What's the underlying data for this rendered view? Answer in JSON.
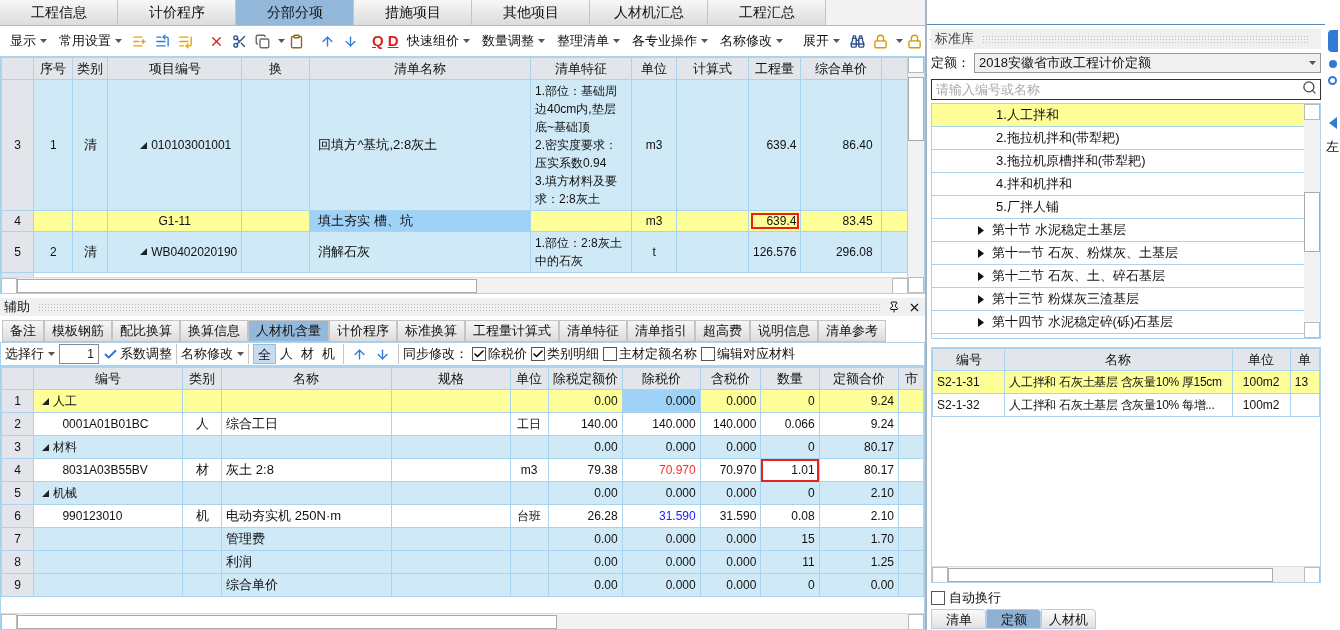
{
  "main_tabs": [
    {
      "label": "工程信息",
      "selected": false
    },
    {
      "label": "计价程序",
      "selected": false
    },
    {
      "label": "分部分项",
      "selected": true
    },
    {
      "label": "措施项目",
      "selected": false
    },
    {
      "label": "其他项目",
      "selected": false
    },
    {
      "label": "人材机汇总",
      "selected": false
    },
    {
      "label": "工程汇总",
      "selected": false
    }
  ],
  "toolbar": {
    "menus_left": [
      "显示",
      "常用设置"
    ],
    "letter_icons": [
      "Q",
      "D"
    ],
    "menus_mid": [
      "快速组价",
      "数量调整",
      "整理清单",
      "各专业操作",
      "名称修改"
    ],
    "menus_right": [
      "展开"
    ]
  },
  "bill_table": {
    "columns": [
      "序号",
      "类别",
      "项目编号",
      "换",
      "清单名称",
      "清单特征",
      "单位",
      "计算式",
      "工程量",
      "综合单价"
    ],
    "rows": [
      {
        "index": "3",
        "seq": "1",
        "type": "清",
        "code": "010103001001",
        "expanded": true,
        "name": "回填方^基坑,2:8灰土",
        "feature": [
          "1.部位：基础周边40cm内,垫层底~基础顶",
          "2.密实度要求：压实系数0.94",
          "3.填方材料及要求：2:8灰土"
        ],
        "unit": "m3",
        "quantity": "639.4",
        "unit_price": "86.40",
        "kind": "bill",
        "selected": false,
        "name_focused": false,
        "flagged": false
      },
      {
        "index": "4",
        "code": "G1-11",
        "name": "填土夯实 槽、坑",
        "unit": "m3",
        "quantity": "639.4",
        "unit_price": "83.45",
        "kind": "quota",
        "selected": true,
        "name_focused": true,
        "flagged": true
      },
      {
        "index": "5",
        "seq": "2",
        "type": "清",
        "code": "WB0402020190",
        "expanded": true,
        "name": "消解石灰",
        "feature": [
          "1.部位：2:8灰土中的石灰"
        ],
        "unit": "t",
        "quantity": "126.576",
        "unit_price": "296.08",
        "kind": "bill",
        "selected": false,
        "name_focused": false,
        "flagged": false
      }
    ]
  },
  "aux_panel": {
    "title": "辅助",
    "tabs": [
      {
        "label": "备注",
        "selected": false
      },
      {
        "label": "模板钢筋",
        "selected": false
      },
      {
        "label": "配比换算",
        "selected": false
      },
      {
        "label": "换算信息",
        "selected": false
      },
      {
        "label": "人材机含量",
        "selected": true
      },
      {
        "label": "计价程序",
        "selected": false
      },
      {
        "label": "标准换算",
        "selected": false
      },
      {
        "label": "工程量计算式",
        "selected": false
      },
      {
        "label": "清单特征",
        "selected": false
      },
      {
        "label": "清单指引",
        "selected": false
      },
      {
        "label": "超高费",
        "selected": false
      },
      {
        "label": "说明信息",
        "selected": false
      },
      {
        "label": "清单参考",
        "selected": false
      }
    ],
    "toolbar": {
      "select_row": "选择行",
      "row_value": "1",
      "coefficient": "系数调整",
      "rename": "名称修改",
      "filters": [
        {
          "label": "全",
          "selected": true
        },
        {
          "label": "人",
          "selected": false
        },
        {
          "label": "材",
          "selected": false
        },
        {
          "label": "机",
          "selected": false
        }
      ],
      "sync_label": "同步修改：",
      "options": [
        {
          "label": "除税价",
          "checked": true
        },
        {
          "label": "类别明细",
          "checked": true
        },
        {
          "label": "主材定额名称",
          "checked": false
        },
        {
          "label": "编辑对应材料",
          "checked": false
        }
      ]
    },
    "table": {
      "columns": [
        "编号",
        "类别",
        "名称",
        "规格",
        "单位",
        "除税定额价",
        "除税价",
        "含税价",
        "数量",
        "定额合价",
        "市"
      ],
      "rows": [
        {
          "index": "1",
          "kind": "group",
          "code": "人工",
          "expanded": true,
          "base_price": "0.00",
          "price": "0.000",
          "tax_price": "0.000",
          "qty": "0",
          "total": "9.24",
          "selected": true,
          "price_focused": true,
          "flagged": false
        },
        {
          "index": "2",
          "kind": "item",
          "code": "0001A01B01BC",
          "type": "人",
          "name": "综合工日",
          "unit": "工日",
          "base_price": "140.00",
          "price": "140.000",
          "tax_price": "140.000",
          "qty": "0.066",
          "total": "9.24",
          "selected": false,
          "price_focused": false,
          "flagged": false
        },
        {
          "index": "3",
          "kind": "group",
          "code": "材料",
          "expanded": true,
          "base_price": "0.00",
          "price": "0.000",
          "tax_price": "0.000",
          "qty": "0",
          "total": "80.17",
          "selected": false,
          "price_focused": false,
          "flagged": false
        },
        {
          "index": "4",
          "kind": "item",
          "code": "8031A03B55BV",
          "type": "材",
          "name": "灰土 2:8",
          "unit": "m3",
          "base_price": "79.38",
          "price": "70.970",
          "color": "#ff2a2a",
          "tax_price": "70.970",
          "qty": "1.01",
          "total": "80.17",
          "selected": false,
          "price_focused": false,
          "flagged": true
        },
        {
          "index": "5",
          "kind": "group",
          "code": "机械",
          "expanded": true,
          "base_price": "0.00",
          "price": "0.000",
          "tax_price": "0.000",
          "qty": "0",
          "total": "2.10",
          "selected": false,
          "price_focused": false,
          "flagged": false
        },
        {
          "index": "6",
          "kind": "item",
          "code": "990123010",
          "type": "机",
          "name": "电动夯实机 250N·m",
          "unit": "台班",
          "base_price": "26.28",
          "price": "31.590",
          "color": "#1a1aff",
          "tax_price": "31.590",
          "qty": "0.08",
          "total": "2.10",
          "selected": false,
          "price_focused": false,
          "flagged": false
        },
        {
          "index": "7",
          "kind": "summary",
          "name": "管理费",
          "base_price": "0.00",
          "price": "0.000",
          "tax_price": "0.000",
          "qty": "15",
          "total": "1.70",
          "selected": false,
          "price_focused": false,
          "flagged": false
        },
        {
          "index": "8",
          "kind": "summary",
          "name": "利润",
          "base_price": "0.00",
          "price": "0.000",
          "tax_price": "0.000",
          "qty": "11",
          "total": "1.25",
          "selected": false,
          "price_focused": false,
          "flagged": false
        },
        {
          "index": "9",
          "kind": "summary",
          "name": "综合单价",
          "base_price": "0.00",
          "price": "0.000",
          "tax_price": "0.000",
          "qty": "0",
          "total": "0.00",
          "selected": false,
          "price_focused": false,
          "flagged": false
        }
      ]
    }
  },
  "library_panel": {
    "title": "标准库",
    "quota_label": "定额：",
    "quota_value": "2018安徽省市政工程计价定额",
    "search": {
      "placeholder": "请输入编号或名称"
    },
    "tree": [
      {
        "label": "1.人工拌和",
        "kind": "leaf",
        "selected": true
      },
      {
        "label": "2.拖拉机拌和(带犁耙)",
        "kind": "leaf",
        "selected": false
      },
      {
        "label": "3.拖拉机原槽拌和(带犁耙)",
        "kind": "leaf",
        "selected": false
      },
      {
        "label": "4.拌和机拌和",
        "kind": "leaf",
        "selected": false
      },
      {
        "label": "5.厂拌人铺",
        "kind": "leaf",
        "selected": false
      },
      {
        "label": "第十节 水泥稳定土基层",
        "kind": "section",
        "selected": false,
        "expanded": false
      },
      {
        "label": "第十一节 石灰、粉煤灰、土基层",
        "kind": "section",
        "selected": false,
        "expanded": false
      },
      {
        "label": "第十二节 石灰、土、碎石基层",
        "kind": "section",
        "selected": false,
        "expanded": false
      },
      {
        "label": "第十三节 粉煤灰三渣基层",
        "kind": "section",
        "selected": false,
        "expanded": false
      },
      {
        "label": "第十四节 水泥稳定碎(砾)石基层",
        "kind": "section",
        "selected": false,
        "expanded": false
      }
    ],
    "table": {
      "columns": [
        "编号",
        "名称",
        "单位",
        "单"
      ],
      "rows": [
        {
          "code": "S2-1-31",
          "name": "人工拌和 石灰土基层 含灰量10% 厚15cm",
          "unit": "100m2",
          "column_4": "13",
          "selected": true
        },
        {
          "code": "S2-1-32",
          "name": "人工拌和 石灰土基层 含灰量10% 每增...",
          "unit": "100m2",
          "selected": false
        }
      ]
    },
    "auto_wrap": {
      "label": "自动换行",
      "checked": false
    },
    "tabs": [
      {
        "label": "清单",
        "selected": false
      },
      {
        "label": "定额",
        "selected": true
      },
      {
        "label": "人材机",
        "selected": false
      }
    ]
  },
  "side_strip": {
    "label": "左"
  }
}
